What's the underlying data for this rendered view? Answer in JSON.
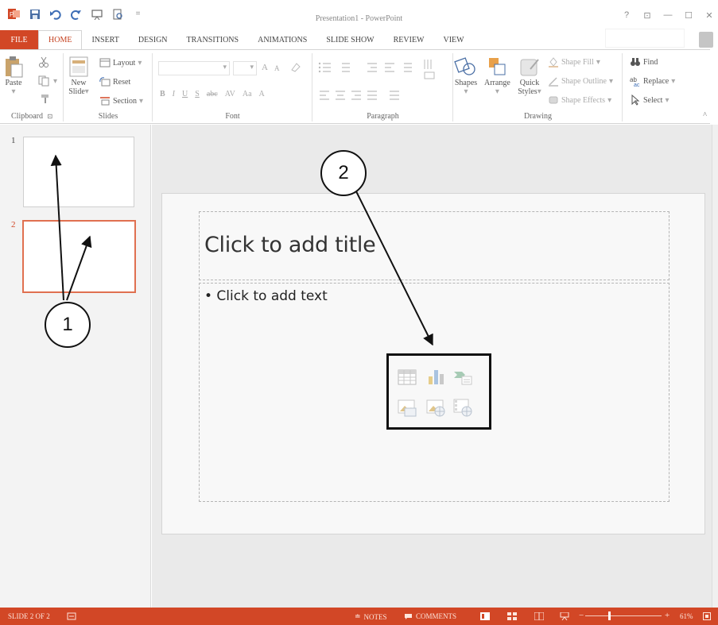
{
  "app": {
    "title": "Presentation1 - PowerPoint",
    "window_controls": [
      "?",
      "⊡",
      "—",
      "☐",
      "✕"
    ]
  },
  "ribbon_tabs": [
    "FILE",
    "HOME",
    "INSERT",
    "DESIGN",
    "TRANSITIONS",
    "ANIMATIONS",
    "SLIDE SHOW",
    "REVIEW",
    "VIEW"
  ],
  "clipboard": {
    "paste_label": "Paste",
    "group_label": "Clipboard",
    "launcher": "⊡"
  },
  "slides_group": {
    "new_slide_line1": "New",
    "new_slide_line2": "Slide",
    "layout_label": "Layout",
    "reset_label": "Reset",
    "section_label": "Section",
    "group_label": "Slides"
  },
  "font_group": {
    "buttons": [
      "B",
      "I",
      "U",
      "S",
      "abc",
      "AV",
      "Aa",
      "A"
    ],
    "grow": "A",
    "shrink": "A",
    "group_label": "Font"
  },
  "paragraph_group": {
    "group_label": "Paragraph"
  },
  "drawing_group": {
    "shapes_label": "Shapes",
    "arrange_label": "Arrange",
    "quick_styles_line1": "Quick",
    "quick_styles_line2": "Styles",
    "shape_fill_label": "Shape Fill",
    "shape_outline_label": "Shape Outline",
    "shape_effects_label": "Shape Effects",
    "group_label": "Drawing"
  },
  "editing_group": {
    "find_label": "Find",
    "replace_label": "Replace",
    "select_label": "Select"
  },
  "thumbnails": [
    {
      "number": "1"
    },
    {
      "number": "2"
    }
  ],
  "slide": {
    "title_placeholder": "Click to add title",
    "body_placeholder": "• Click to add text"
  },
  "callouts": {
    "one": "1",
    "two": "2"
  },
  "status": {
    "slide_counter": "SLIDE 2 OF 2",
    "notes_label": "NOTES",
    "comments_label": "COMMENTS",
    "zoom_minus": "−",
    "zoom_plus": "+",
    "zoom_level": "61%"
  },
  "colors": {
    "accent": "#d24726",
    "selected_thumb": "#e07050"
  }
}
